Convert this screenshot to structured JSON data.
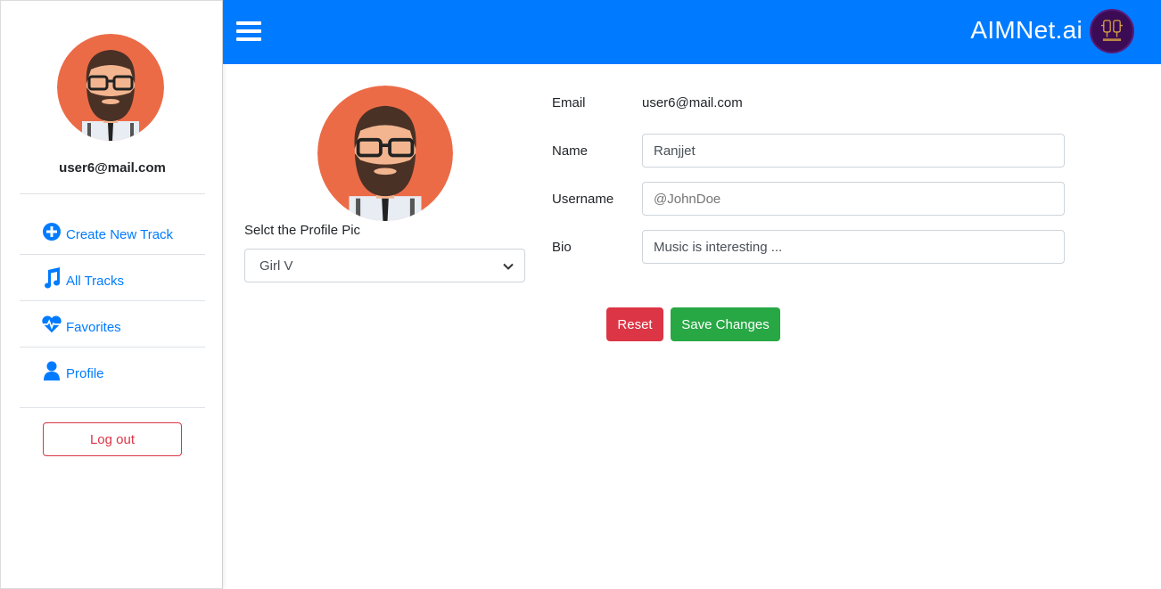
{
  "header": {
    "brand": "AIMNet.ai"
  },
  "sidebar": {
    "email": "user6@mail.com",
    "items": [
      {
        "label": "Create New Track",
        "icon": "plus-circle-icon"
      },
      {
        "label": "All Tracks",
        "icon": "music-note-icon"
      },
      {
        "label": "Favorites",
        "icon": "heart-pulse-icon"
      },
      {
        "label": "Profile",
        "icon": "user-icon"
      }
    ],
    "logout_label": "Log out"
  },
  "profile": {
    "pic_label": "Selct the Profile Pic",
    "pic_selected": "Girl V",
    "email_label": "Email",
    "email_value": "user6@mail.com",
    "name_label": "Name",
    "name_value": "Ranjjet",
    "username_label": "Username",
    "username_placeholder": "@JohnDoe",
    "bio_label": "Bio",
    "bio_value": "Music is interesting ..."
  },
  "actions": {
    "reset_label": "Reset",
    "save_label": "Save Changes"
  },
  "colors": {
    "primary": "#007bff",
    "danger": "#dc3545",
    "success": "#28a745",
    "avatar_bg": "#ec6b47"
  }
}
